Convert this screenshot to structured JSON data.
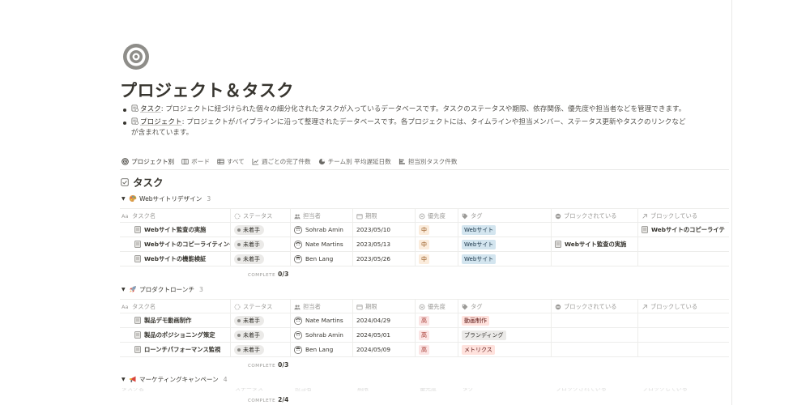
{
  "page": {
    "title": "プロジェクト＆タスク",
    "icon": "target-icon",
    "descriptions": [
      {
        "icon": "database-page-icon",
        "link": "タスク",
        "text": ": プロジェクトに紐づけられた個々の細分化されたタスクが入っているデータベースです。タスクのステータスや期限、依存関係、優先度や担当者などを管理できます。"
      },
      {
        "icon": "database-page-icon",
        "link": "プロジェクト",
        "text": ": プロジェクトがパイプラインに沿って整理されたデータベースです。各プロジェクトには、タイムラインや担当メンバー、ステータス更新やタスクのリンクなどが含まれています。"
      }
    ]
  },
  "views": [
    {
      "label": "プロジェクト別",
      "icon": "target-icon",
      "active": true
    },
    {
      "label": "ボード",
      "icon": "board-icon",
      "active": false
    },
    {
      "label": "すべて",
      "icon": "table-icon",
      "active": false
    },
    {
      "label": "週ごとの完了件数",
      "icon": "line-chart-icon",
      "active": false
    },
    {
      "label": "チーム別 平均遅延日数",
      "icon": "pie-chart-icon",
      "active": false
    },
    {
      "label": "担当別タスク件数",
      "icon": "bar-chart-icon",
      "active": false
    }
  ],
  "database": {
    "title": "タスク",
    "columns": {
      "name": "タスク名",
      "status": "ステータス",
      "assignee": "担当者",
      "due": "期限",
      "priority": "優先度",
      "tags": "タグ",
      "blocked_by": "ブロックされている",
      "blocking": "ブロックしている"
    },
    "complete_label": "COMPLETE",
    "groups": [
      {
        "name": "Webサイトリデザイン",
        "emoji": "paint-palette-icon",
        "count": "3",
        "complete": "0/3",
        "rows": [
          {
            "name": "Webサイト監査の実施",
            "status": "未着手",
            "assignee": "Sohrab Amin",
            "due": "2023/05/10",
            "priority": "中",
            "tag": "Webサイト",
            "blocked_by": "",
            "blocking": "Webサイトのコピーライテ"
          },
          {
            "name": "Webサイトのコピーライティング",
            "status": "未着手",
            "assignee": "Nate Martins",
            "due": "2023/05/13",
            "priority": "中",
            "tag": "Webサイト",
            "blocked_by": "Webサイト監査の実施",
            "blocking": ""
          },
          {
            "name": "Webサイトの機能検証",
            "status": "未着手",
            "assignee": "Ben Lang",
            "due": "2023/05/26",
            "priority": "中",
            "tag": "Webサイト",
            "blocked_by": "",
            "blocking": ""
          }
        ]
      },
      {
        "name": "プロダクトローンチ",
        "emoji": "rocket-icon",
        "count": "3",
        "complete": "0/3",
        "rows": [
          {
            "name": "製品デモ動画制作",
            "status": "未着手",
            "assignee": "Nate Martins",
            "due": "2024/04/29",
            "priority": "高",
            "tag": "動画制作",
            "blocked_by": "",
            "blocking": ""
          },
          {
            "name": "製品のポジショニング策定",
            "status": "未着手",
            "assignee": "Sohrab Amin",
            "due": "2024/05/01",
            "priority": "高",
            "tag": "ブランディング",
            "blocked_by": "",
            "blocking": ""
          },
          {
            "name": "ローンチパフォーマンス監視",
            "status": "未着手",
            "assignee": "Ben Lang",
            "due": "2024/05/09",
            "priority": "高",
            "tag": "メトリクス",
            "blocked_by": "",
            "blocking": ""
          }
        ]
      },
      {
        "name": "マーケティングキャンペーン",
        "emoji": "megaphone-icon",
        "count": "4",
        "complete": "2/4",
        "rows": []
      }
    ]
  },
  "colors": {
    "text": "#37352f",
    "muted": "#9b9a97",
    "tag_blue": "#d3e5ef",
    "tag_red": "#ffe2dd",
    "tag_gray": "#ebeae8",
    "priority_mid": "#fbecdc",
    "priority_high": "#fbe4e4"
  }
}
